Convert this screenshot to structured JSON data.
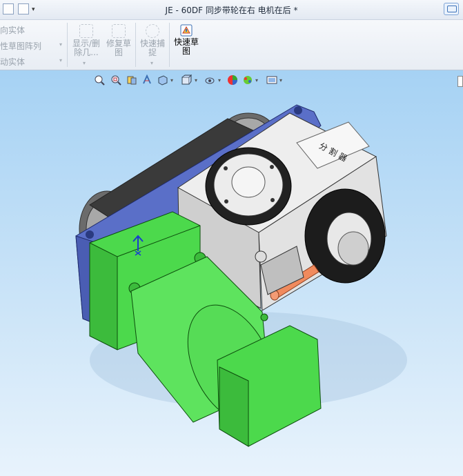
{
  "window": {
    "title": "JE - 60DF 同步带轮在右 电机在后 *"
  },
  "ribbon": {
    "left_items": [
      "向实体",
      "性草图阵列",
      "动实体"
    ],
    "buttons": [
      {
        "line1": "显示/删",
        "line2": "除几...",
        "icon": "show-delete-relations-icon",
        "enabled": false
      },
      {
        "line1": "修复草",
        "line2": "图",
        "icon": "repair-sketch-icon",
        "enabled": false
      },
      {
        "line1": "快速捕",
        "line2": "捉",
        "icon": "quick-snaps-icon",
        "enabled": false
      },
      {
        "line1": "快速草",
        "line2": "图",
        "icon": "rapid-sketch-icon",
        "enabled": true
      }
    ]
  },
  "view_toolbar": [
    "zoom-to-fit-icon",
    "zoom-to-area-icon",
    "previous-view-icon",
    "section-view-icon",
    "dynamic-annotation-icon",
    "view-orientation-icon",
    "display-style-icon",
    "hide-show-items-icon",
    "edit-appearance-icon",
    "apply-scene-icon",
    "view-settings-icon"
  ],
  "colors": {
    "accent": "#3b6fb3",
    "motor_green": "#4cd94c",
    "base_plate": "#6f84d6",
    "housing_gray": "#c9ced6",
    "background": "#b9dcf6"
  }
}
